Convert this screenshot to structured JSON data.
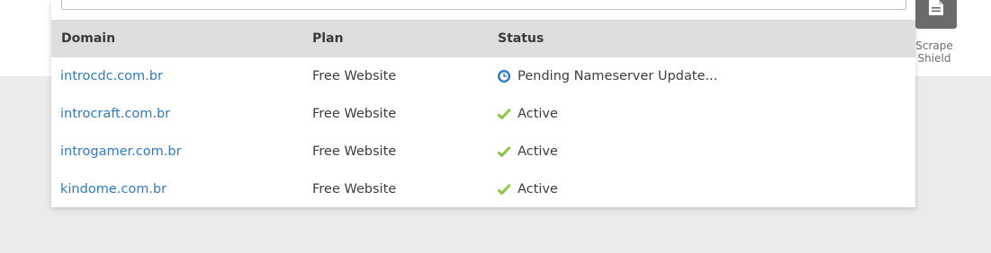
{
  "table": {
    "headers": {
      "domain": "Domain",
      "plan": "Plan",
      "status": "Status"
    },
    "rows": [
      {
        "domain": "introcdc.com.br",
        "plan": "Free Website",
        "status": "Pending Nameserver Update...",
        "status_icon": "clock-icon"
      },
      {
        "domain": "introcraft.com.br",
        "plan": "Free Website",
        "status": "Active",
        "status_icon": "check-icon"
      },
      {
        "domain": "introgamer.com.br",
        "plan": "Free Website",
        "status": "Active",
        "status_icon": "check-icon"
      },
      {
        "domain": "kindome.com.br",
        "plan": "Free Website",
        "status": "Active",
        "status_icon": "check-icon"
      }
    ]
  },
  "side_tool": {
    "label": "Scrape Shield",
    "icon": "document-icon"
  },
  "colors": {
    "link": "#2f7bbf",
    "active_check": "#8cc63f",
    "pending_clock": "#2f7bbf",
    "header_bg": "#dedede",
    "page_bg": "#ebebeb"
  }
}
